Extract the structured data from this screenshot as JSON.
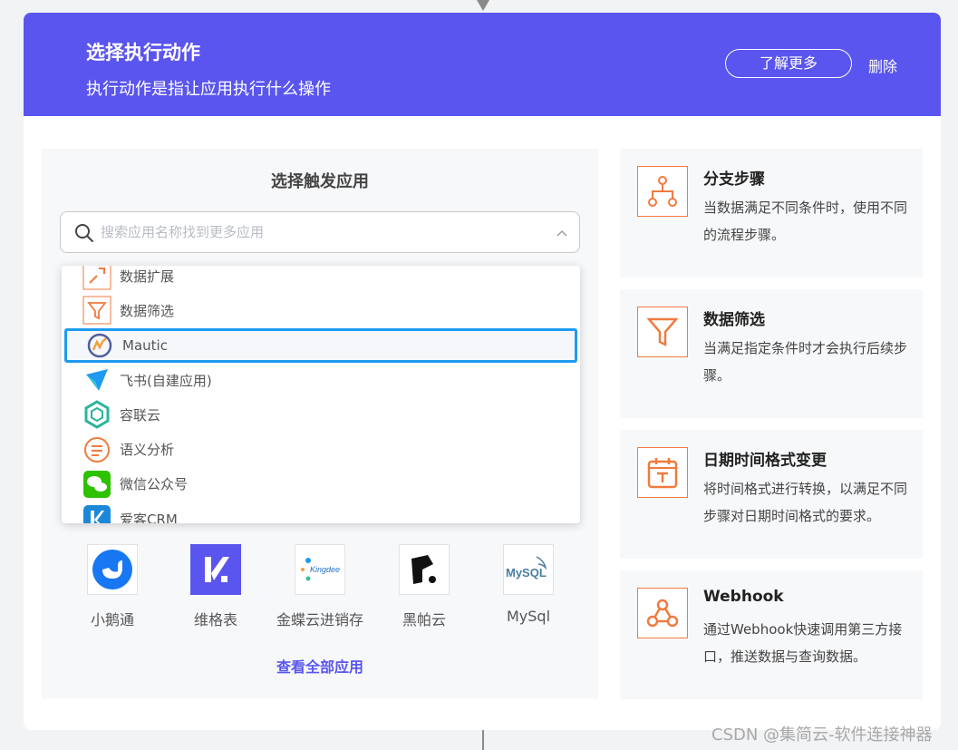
{
  "header": {
    "title": "选择执行动作",
    "subtitle": "执行动作是指让应用执行什么操作",
    "learn_more_label": "了解更多",
    "delete_label": "删除",
    "background_color": "#5a55ee"
  },
  "trigger_panel": {
    "title": "选择触发应用",
    "search": {
      "placeholder": "搜索应用名称找到更多应用",
      "value": ""
    },
    "dropdown_items": [
      {
        "label": "数据扩展",
        "icon": "data-expand-icon"
      },
      {
        "label": "数据筛选",
        "icon": "filter-icon"
      },
      {
        "label": "Mautic",
        "icon": "mautic-logo-icon",
        "selected": true
      },
      {
        "label": "飞书(自建应用)",
        "icon": "feishu-logo-icon"
      },
      {
        "label": "容联云",
        "icon": "ronglianyun-logo-icon"
      },
      {
        "label": "语义分析",
        "icon": "semantic-analysis-icon"
      },
      {
        "label": "微信公众号",
        "icon": "wechat-logo-icon"
      },
      {
        "label": "爱客CRM",
        "icon": "aike-crm-logo-icon"
      }
    ],
    "popular_apps": [
      {
        "name": "小鹅通",
        "icon": "xiaoetong-logo-icon"
      },
      {
        "name": "维格表",
        "icon": "vika-logo-icon"
      },
      {
        "name": "金蝶云进销存",
        "icon": "kingdee-logo-icon",
        "logo_text": "Kingdee"
      },
      {
        "name": "黑帕云",
        "icon": "heipayun-logo-icon"
      },
      {
        "name": "MySql",
        "icon": "mysql-logo-icon",
        "logo_text": "MySQL"
      }
    ],
    "view_all_label": "查看全部应用"
  },
  "steps": [
    {
      "title": "分支步骤",
      "description": "当数据满足不同条件时，使用不同的流程步骤。",
      "icon": "branch-icon"
    },
    {
      "title": "数据筛选",
      "description": "当满足指定条件时才会执行后续步骤。",
      "icon": "filter-icon"
    },
    {
      "title": "日期时间格式变更",
      "description": "将时间格式进行转换，以满足不同步骤对日期时间格式的要求。",
      "icon": "calendar-icon"
    },
    {
      "title": "Webhook",
      "description": "通过Webhook快速调用第三方接口，推送数据与查询数据。",
      "icon": "webhook-icon"
    }
  ],
  "watermark": "CSDN @集简云-软件连接神器",
  "colors": {
    "accent": "#5a55ee",
    "step_icon": "#f07b3f",
    "selected_border": "#1e9bf0"
  }
}
